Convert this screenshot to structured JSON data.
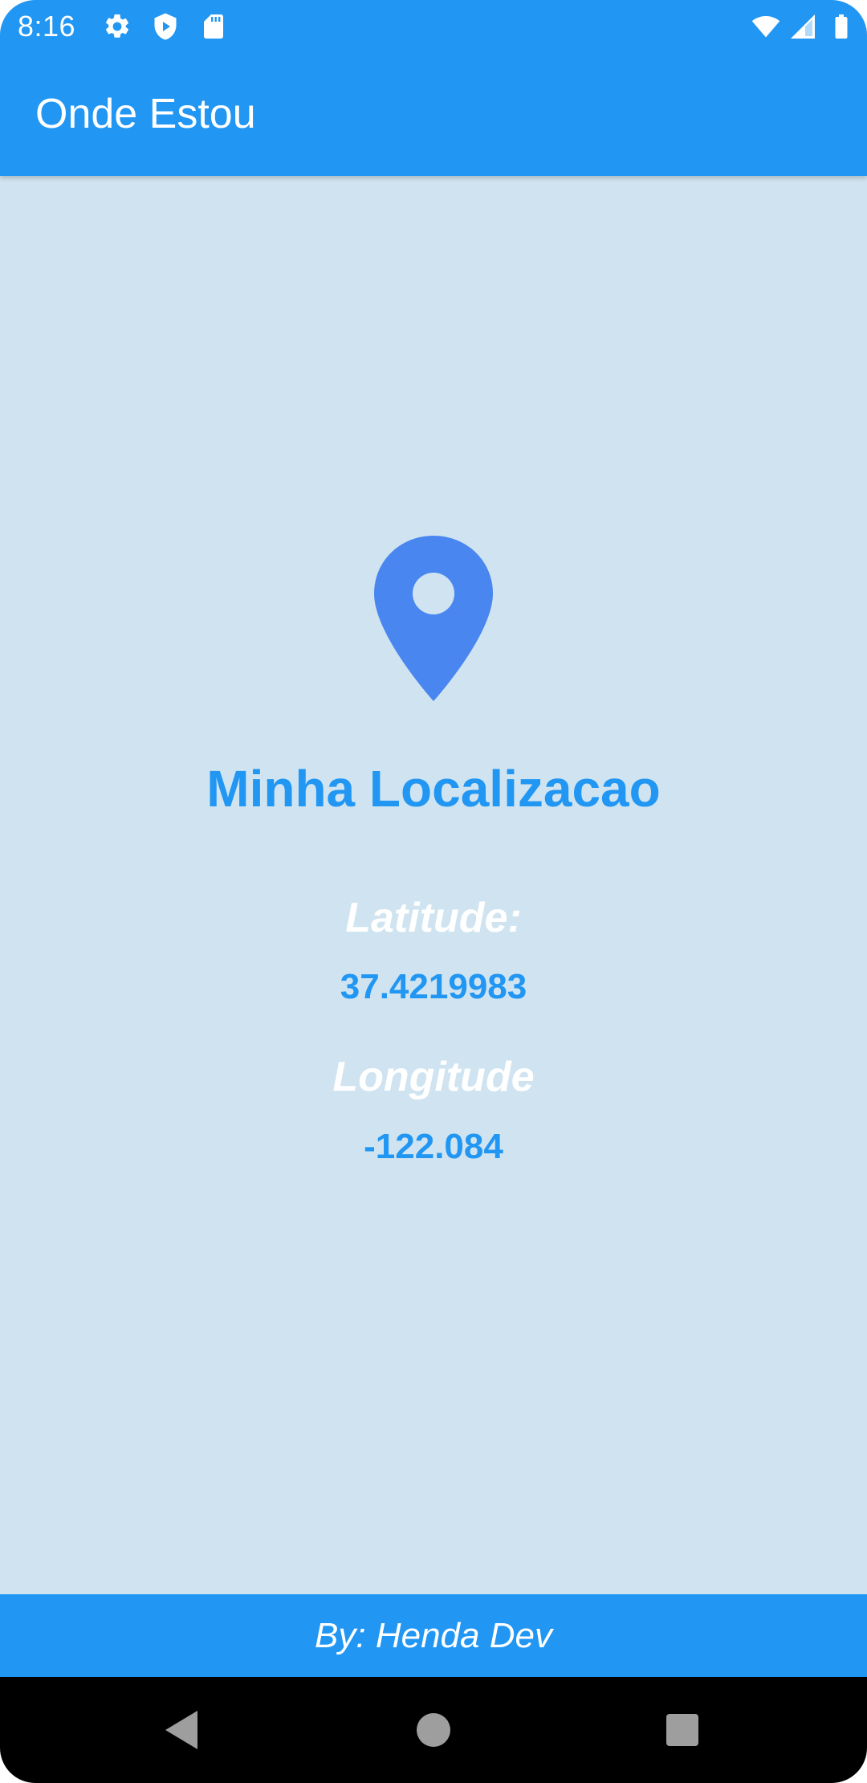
{
  "status_bar": {
    "time": "8:16",
    "left_icons": [
      "gear-icon",
      "shield-play-icon",
      "sd-card-icon"
    ],
    "right_icons": [
      "wifi-icon",
      "cell-signal-icon",
      "battery-icon"
    ]
  },
  "app_bar": {
    "title": "Onde Estou"
  },
  "main": {
    "icon": "location-pin-icon",
    "headline": "Minha Localizacao",
    "latitude_label": "Latitude:",
    "latitude_value": "37.4219983",
    "longitude_label": "Longitude",
    "longitude_value": "-122.084"
  },
  "footer": {
    "text": "By: Henda Dev"
  },
  "nav_bar": {
    "buttons": [
      "back-icon",
      "home-icon",
      "recents-icon"
    ]
  },
  "colors": {
    "primary": "#2196f3",
    "background": "#cfe4f0",
    "pin": "#4a86f0",
    "text_white": "#ffffff"
  }
}
